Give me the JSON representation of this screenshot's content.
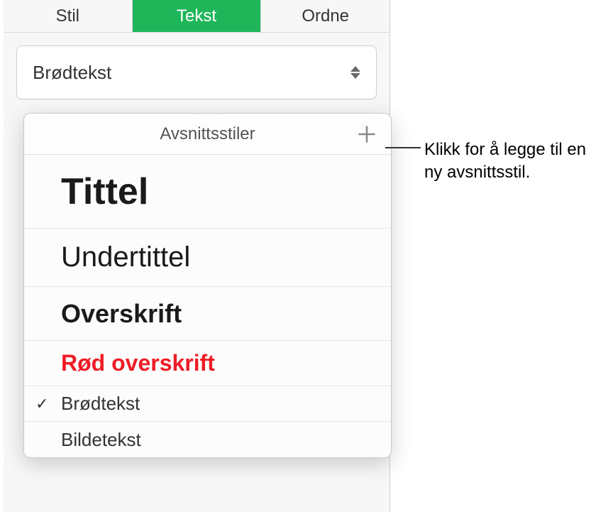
{
  "tabs": {
    "stil": "Stil",
    "tekst": "Tekst",
    "ordne": "Ordne"
  },
  "dropdown": {
    "selected": "Brødtekst"
  },
  "popover": {
    "title": "Avsnittsstiler",
    "styles": {
      "tittel": "Tittel",
      "undertittel": "Undertittel",
      "overskrift": "Overskrift",
      "rod_overskrift": "Rød overskrift",
      "brodtekst": "Brødtekst",
      "bildetekst": "Bildetekst"
    }
  },
  "callout": {
    "text": "Klikk for å legge til en ny avsnittsstil."
  }
}
